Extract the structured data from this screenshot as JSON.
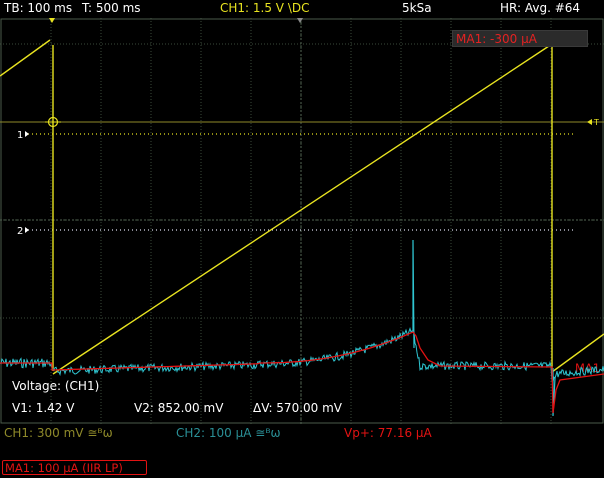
{
  "status_bar": {
    "timebase": "TB: 100 ms",
    "trigger_time": "T: 500 ms",
    "channel": "CH1: 1.5 V \\DC",
    "sample_rate": "5kSa",
    "mode": "HR: Avg. #64"
  },
  "markers": {
    "ch1": "1",
    "ch2": "2",
    "trigger": "T",
    "math_label": "MA1"
  },
  "math_tag": "MA1: -300 µA",
  "cursor_panel": {
    "title": "Voltage: (CH1)",
    "v1": "V1: 1.42 V",
    "v2": "V2: 852.00 mV",
    "dv": "ΔV: 570.00 mV"
  },
  "channel_bar": {
    "ch1": "CH1: 300 mV ≅ᴮω",
    "ch2": "CH2: 100 µA ≅ᴮω",
    "vp": "Vp+: 77.16 µA"
  },
  "math_box": "MA1: 100 µA (IIR LP)",
  "colors": {
    "ch1": "#e8e320",
    "ch2": "#2fc6d2",
    "math": "#e21313",
    "grid": "#3a4a3a",
    "ch1_dim": "#8f8a2a",
    "ch2_dim": "#2a8f96"
  }
}
